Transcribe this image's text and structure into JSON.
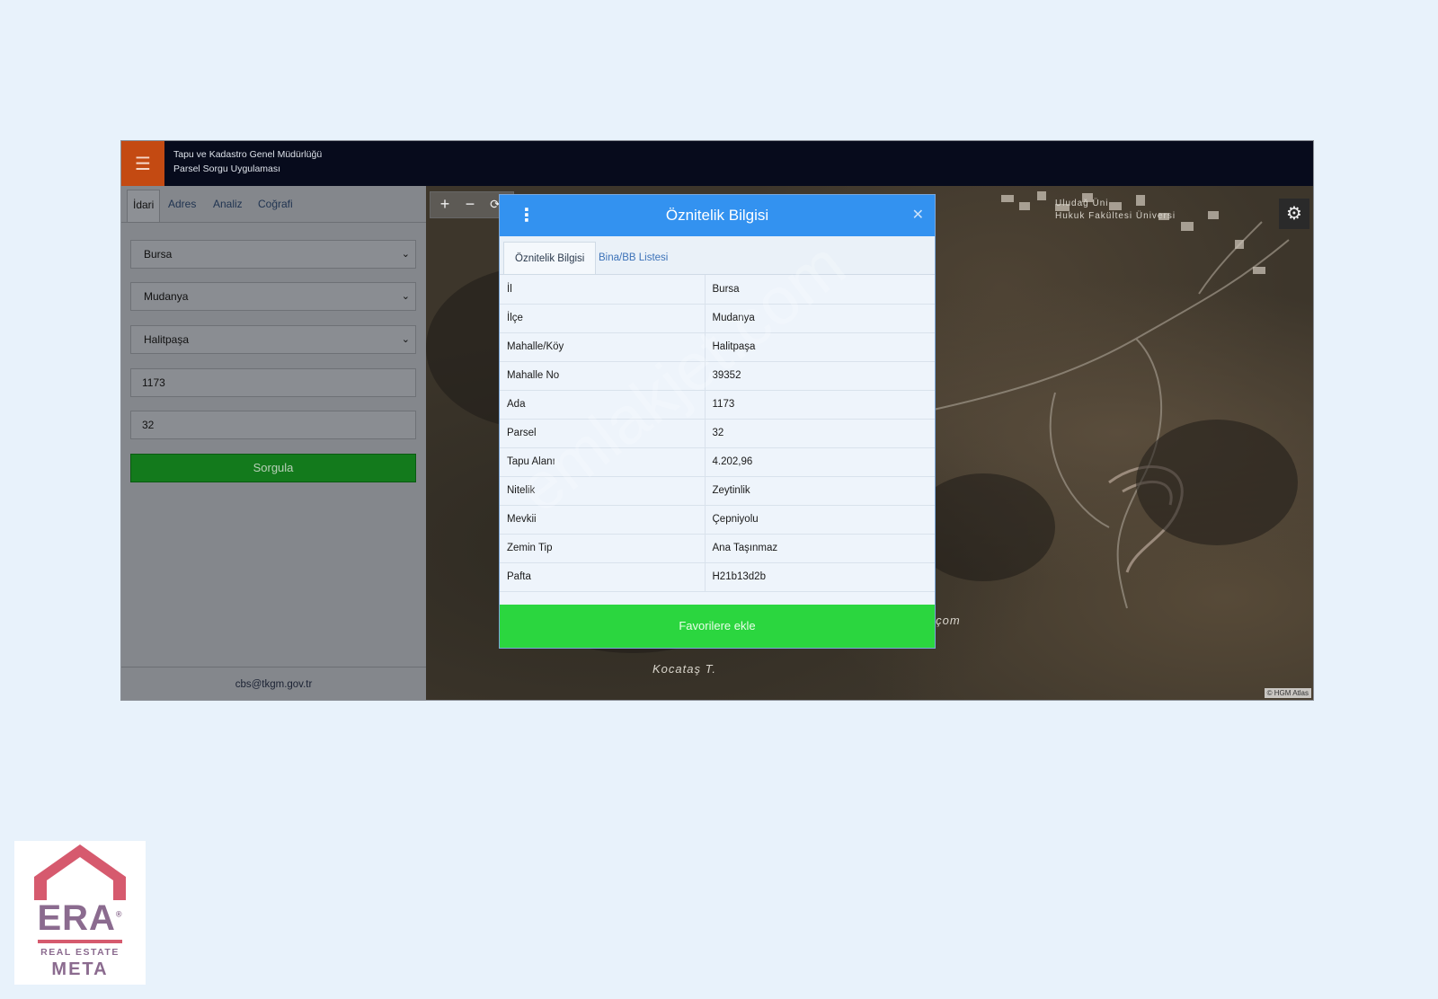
{
  "header": {
    "title_line1": "Tapu ve Kadastro Genel Müdürlüğü",
    "title_line2": "Parsel Sorgu Uygulaması"
  },
  "sidebar": {
    "tabs": [
      {
        "label": "İdari",
        "active": true
      },
      {
        "label": "Adres",
        "active": false
      },
      {
        "label": "Analiz",
        "active": false
      },
      {
        "label": "Coğrafi",
        "active": false
      }
    ],
    "fields": {
      "il": "Bursa",
      "ilce": "Mudanya",
      "mahalle": "Halitpaşa",
      "ada": "1173",
      "parsel": "32"
    },
    "query_button": "Sorgula",
    "footer_email": "cbs@tkgm.gov.tr"
  },
  "map": {
    "labels": {
      "place1": "dlçom",
      "place2": "Kocataş T.",
      "campus1": "Uludağ Üni",
      "campus2": "Hukuk Fakültesi Üniversi"
    },
    "attribution": "© HGM Atlas"
  },
  "modal": {
    "title": "Öznitelik Bilgisi",
    "tabs": [
      "Öznitelik Bilgisi",
      "Bina/BB Listesi"
    ],
    "rows": [
      {
        "key": "İl",
        "value": "Bursa"
      },
      {
        "key": "İlçe",
        "value": "Mudanya"
      },
      {
        "key": "Mahalle/Köy",
        "value": "Halitpaşa"
      },
      {
        "key": "Mahalle No",
        "value": "39352"
      },
      {
        "key": "Ada",
        "value": "1173"
      },
      {
        "key": "Parsel",
        "value": "32"
      },
      {
        "key": "Tapu Alanı",
        "value": "4.202,96"
      },
      {
        "key": "Nitelik",
        "value": "Zeytinlik"
      },
      {
        "key": "Mevkii",
        "value": "Çepniyolu"
      },
      {
        "key": "Zemin Tip",
        "value": "Ana Taşınmaz"
      },
      {
        "key": "Pafta",
        "value": "H21b13d2b"
      }
    ],
    "favorite_button": "Favorilere ekle"
  },
  "watermark": "emlakjet.com",
  "logo": {
    "brand": "ERA",
    "registered": "®",
    "line2": "REAL ESTATE",
    "line3": "META"
  },
  "colors": {
    "menu_accent": "#c44a12",
    "modal_header": "#3392f0",
    "favorite_button": "#2bd63f",
    "query_button": "#137a1c"
  }
}
